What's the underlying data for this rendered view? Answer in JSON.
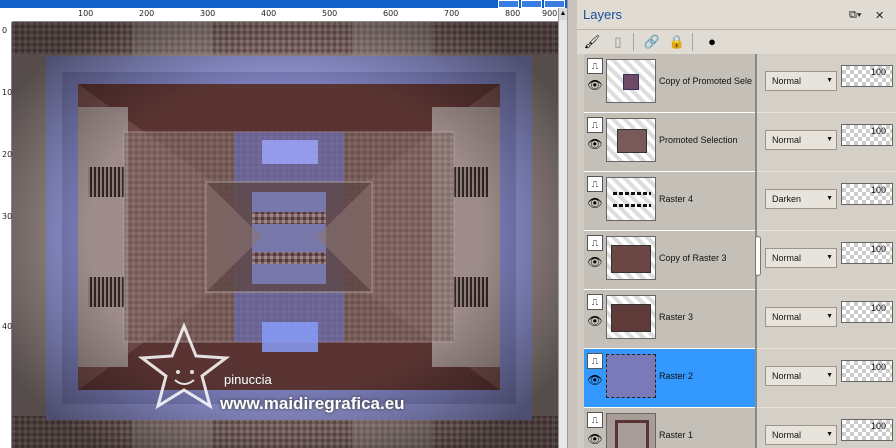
{
  "window": {
    "title": ""
  },
  "ruler": {
    "horizontal_labels": [
      "100",
      "200",
      "300",
      "400",
      "500",
      "600",
      "700",
      "800",
      "900"
    ],
    "vertical_labels": [
      "0",
      "100",
      "200",
      "300",
      "400"
    ]
  },
  "canvas": {
    "watermark_name": "pinuccia",
    "watermark_url": "www.maidiregrafica.eu",
    "colors": {
      "border": "#8d90cc",
      "brown": "#5a3432",
      "taupe": "#9b8b86",
      "blue": "#8aa0ff"
    }
  },
  "layers_panel": {
    "title": "Layers",
    "header_icons": [
      "dock-icon",
      "close-icon"
    ],
    "toolbar": [
      "paint-icon",
      "document-icon",
      "link-icon",
      "lock-icon",
      "mask-icon"
    ],
    "layers": [
      {
        "name": "Copy of Promoted Sele",
        "mode": "Normal",
        "opacity": "100",
        "selected": false
      },
      {
        "name": "Promoted Selection",
        "mode": "Normal",
        "opacity": "100",
        "selected": false
      },
      {
        "name": "Raster 4",
        "mode": "Darken",
        "opacity": "100",
        "selected": false
      },
      {
        "name": "Copy of Raster 3",
        "mode": "Normal",
        "opacity": "100",
        "selected": false
      },
      {
        "name": "Raster 3",
        "mode": "Normal",
        "opacity": "100",
        "selected": false
      },
      {
        "name": "Raster 2",
        "mode": "Normal",
        "opacity": "100",
        "selected": true
      },
      {
        "name": "Raster 1",
        "mode": "Normal",
        "opacity": "100",
        "selected": false
      }
    ],
    "colors": {
      "selected": "#3399ff"
    }
  }
}
